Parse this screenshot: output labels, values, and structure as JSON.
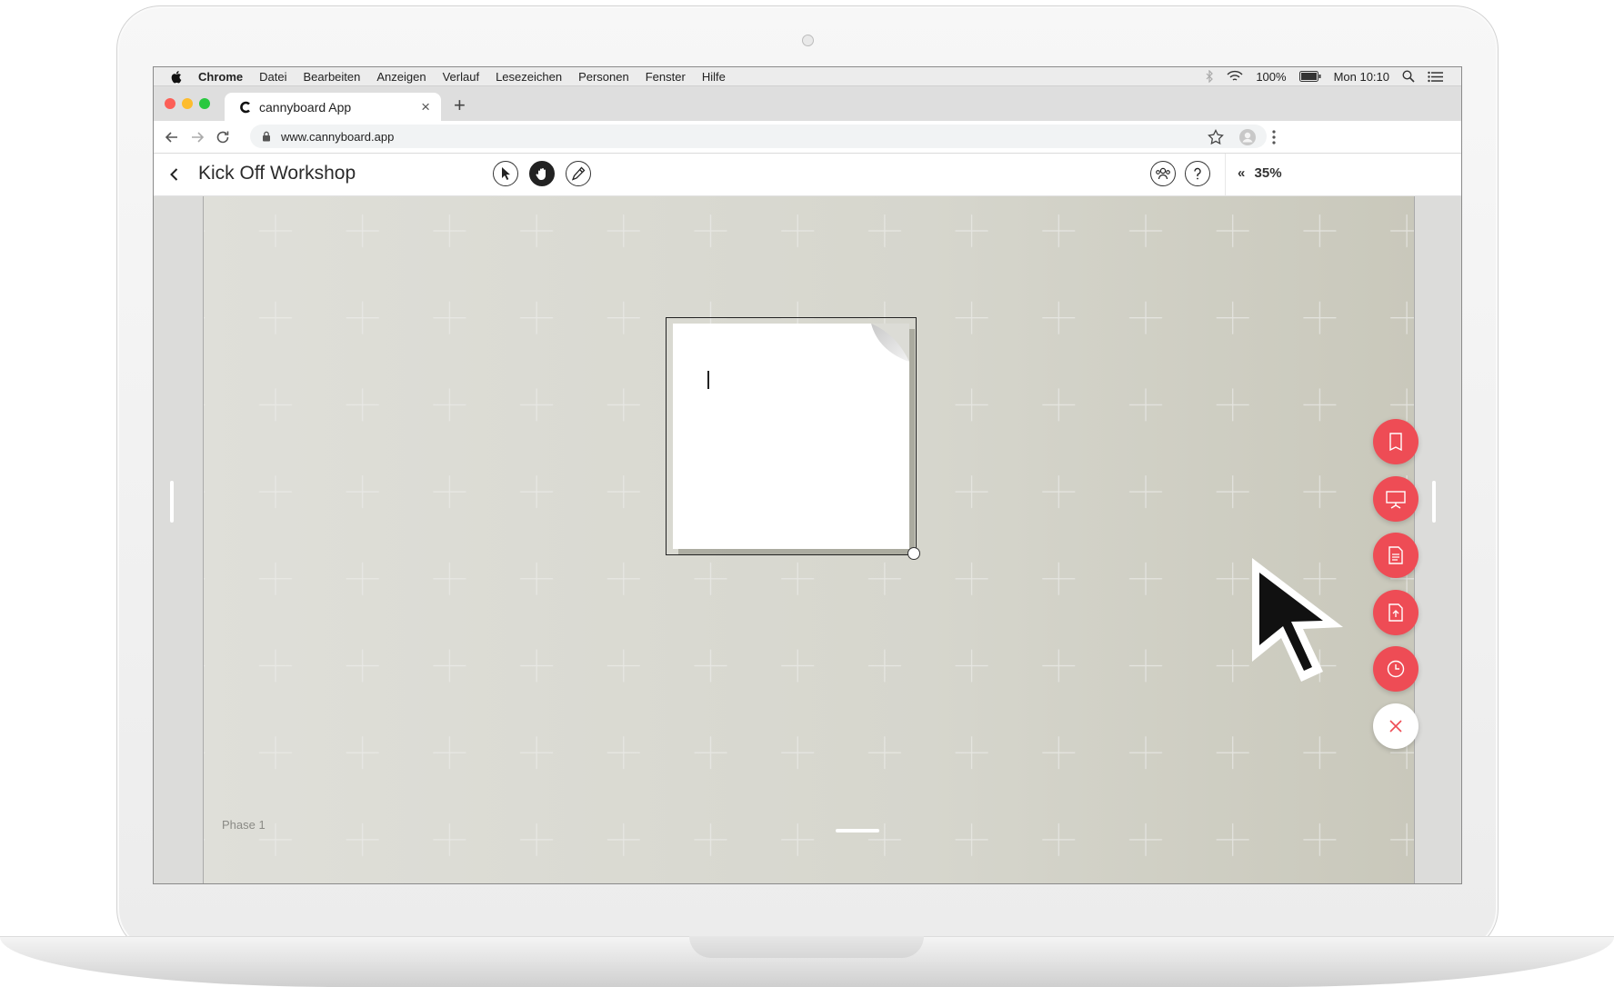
{
  "menubar": {
    "items": [
      "Chrome",
      "Datei",
      "Bearbeiten",
      "Anzeigen",
      "Verlauf",
      "Lesezeichen",
      "Personen",
      "Fenster",
      "Hilfe"
    ],
    "battery": "100%",
    "clock": "Mon 10:10"
  },
  "browser": {
    "tab_title": "cannyboard App",
    "url": "www.cannyboard.app"
  },
  "app": {
    "title": "Kick Off Workshop",
    "tools": [
      "pointer-tool",
      "hand-tool",
      "pen-tool"
    ],
    "active_tool": "hand-tool",
    "zoom": "35%",
    "zoom_prefix": "«",
    "phase_label": "Phase 1"
  },
  "fab_menu": {
    "items": [
      "sticky-note-icon",
      "presentation-icon",
      "document-icon",
      "upload-file-icon",
      "clock-icon",
      "close-icon"
    ],
    "accent": "#ee4c55"
  }
}
